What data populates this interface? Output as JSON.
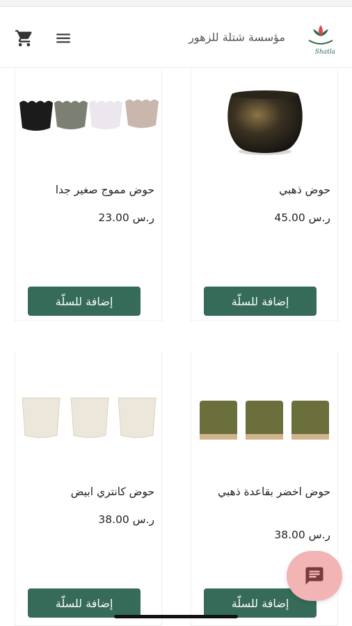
{
  "header": {
    "brand_name": "مؤسسة شتلة للزهور",
    "logo_text": "Shatla",
    "cart_icon": "cart-icon",
    "menu_icon": "menu-icon"
  },
  "colors": {
    "accent": "#356b58",
    "fab": "#f2b4b4",
    "fab_icon": "#7a3a3a"
  },
  "products": [
    {
      "title": "حوض ذهبي",
      "price": "45.00 ر.س",
      "button": "إضافة للسلّة",
      "image": "black-gold-round-pot"
    },
    {
      "title": "حوض مموج صغير جدا",
      "price": "23.00 ر.س",
      "button": "إضافة للسلّة",
      "image": "four-wavy-pots"
    },
    {
      "title": "حوض اخضر بقاعدة ذهبي",
      "price": "38.00 ر.س",
      "button": "إضافة للسلّة",
      "image": "three-green-pots"
    },
    {
      "title": "حوض كانتري ابيض",
      "price": "38.00 ر.س",
      "button": "إضافة للسلّة",
      "image": "three-white-pots"
    }
  ],
  "chat": {
    "icon": "chat-icon"
  }
}
